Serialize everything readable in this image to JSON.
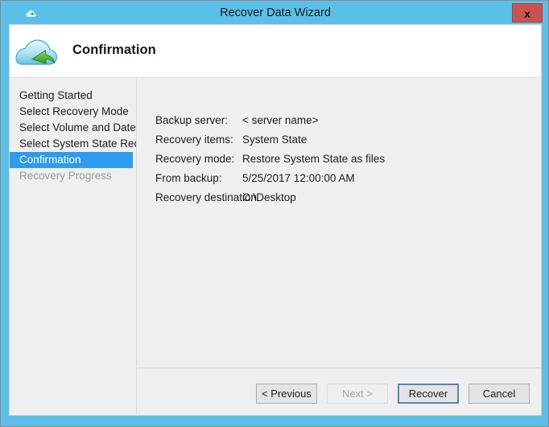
{
  "window": {
    "title": "Recover Data Wizard",
    "title_icon": "cloud-icon",
    "close_label": "x",
    "accent_color": "#5bc0e9",
    "close_color": "#c75450"
  },
  "header": {
    "title": "Confirmation",
    "icon": "cloud-restore-icon"
  },
  "sidebar": {
    "items": [
      {
        "label": "Getting Started",
        "state": "normal"
      },
      {
        "label": "Select Recovery Mode",
        "state": "normal"
      },
      {
        "label": "Select Volume and Date",
        "state": "normal"
      },
      {
        "label": "Select System State Reco...",
        "state": "normal"
      },
      {
        "label": "Confirmation",
        "state": "active"
      },
      {
        "label": "Recovery Progress",
        "state": "disabled"
      }
    ],
    "active_color": "#2e9bf0"
  },
  "details": [
    {
      "label": "Backup server:",
      "value": "< server name>"
    },
    {
      "label": "Recovery items:",
      "value": "System State"
    },
    {
      "label": "Recovery mode:",
      "value": "Restore System State as files"
    },
    {
      "label": "From backup:",
      "value": "5/25/2017 12:00:00 AM"
    },
    {
      "label": "Recovery destination",
      "value": "C:\\Desktop"
    }
  ],
  "buttons": [
    {
      "label": "< Previous",
      "state": "normal"
    },
    {
      "label": "Next >",
      "state": "disabled"
    },
    {
      "label": "Recover",
      "state": "default"
    },
    {
      "label": "Cancel",
      "state": "normal"
    }
  ]
}
